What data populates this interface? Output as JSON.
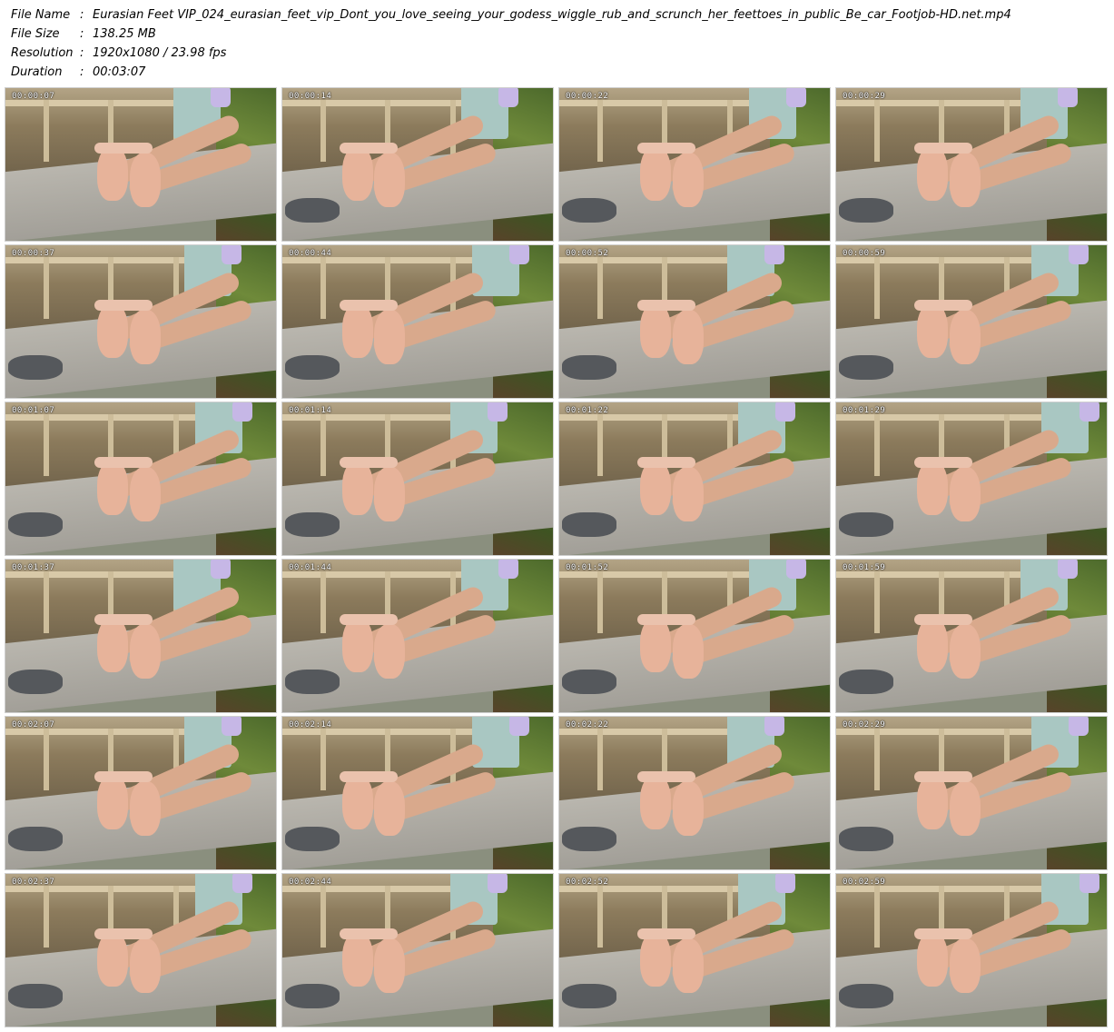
{
  "meta": {
    "file_name_label": "File Name",
    "file_name": "Eurasian Feet VIP_024_eurasian_feet_vip_Dont_you_love_seeing_your_godess_wiggle_rub_and_scrunch_her_feettoes_in_public_Be_car_Footjob-HD.net.mp4",
    "file_size_label": "File Size",
    "file_size": "138.25 MB",
    "resolution_label": "Resolution",
    "resolution": "1920x1080 / 23.98 fps",
    "duration_label": "Duration",
    "duration": "00:03:07",
    "separator": ":"
  },
  "thumbnails": [
    {
      "timestamp": "00:00:07"
    },
    {
      "timestamp": "00:00:14"
    },
    {
      "timestamp": "00:00:22"
    },
    {
      "timestamp": "00:00:29"
    },
    {
      "timestamp": "00:00:37"
    },
    {
      "timestamp": "00:00:44"
    },
    {
      "timestamp": "00:00:52"
    },
    {
      "timestamp": "00:00:59"
    },
    {
      "timestamp": "00:01:07"
    },
    {
      "timestamp": "00:01:14"
    },
    {
      "timestamp": "00:01:22"
    },
    {
      "timestamp": "00:01:29"
    },
    {
      "timestamp": "00:01:37"
    },
    {
      "timestamp": "00:01:44"
    },
    {
      "timestamp": "00:01:52"
    },
    {
      "timestamp": "00:01:59"
    },
    {
      "timestamp": "00:02:07"
    },
    {
      "timestamp": "00:02:14"
    },
    {
      "timestamp": "00:02:22"
    },
    {
      "timestamp": "00:02:29"
    },
    {
      "timestamp": "00:02:37"
    },
    {
      "timestamp": "00:02:44"
    },
    {
      "timestamp": "00:02:52"
    },
    {
      "timestamp": "00:02:59"
    }
  ]
}
